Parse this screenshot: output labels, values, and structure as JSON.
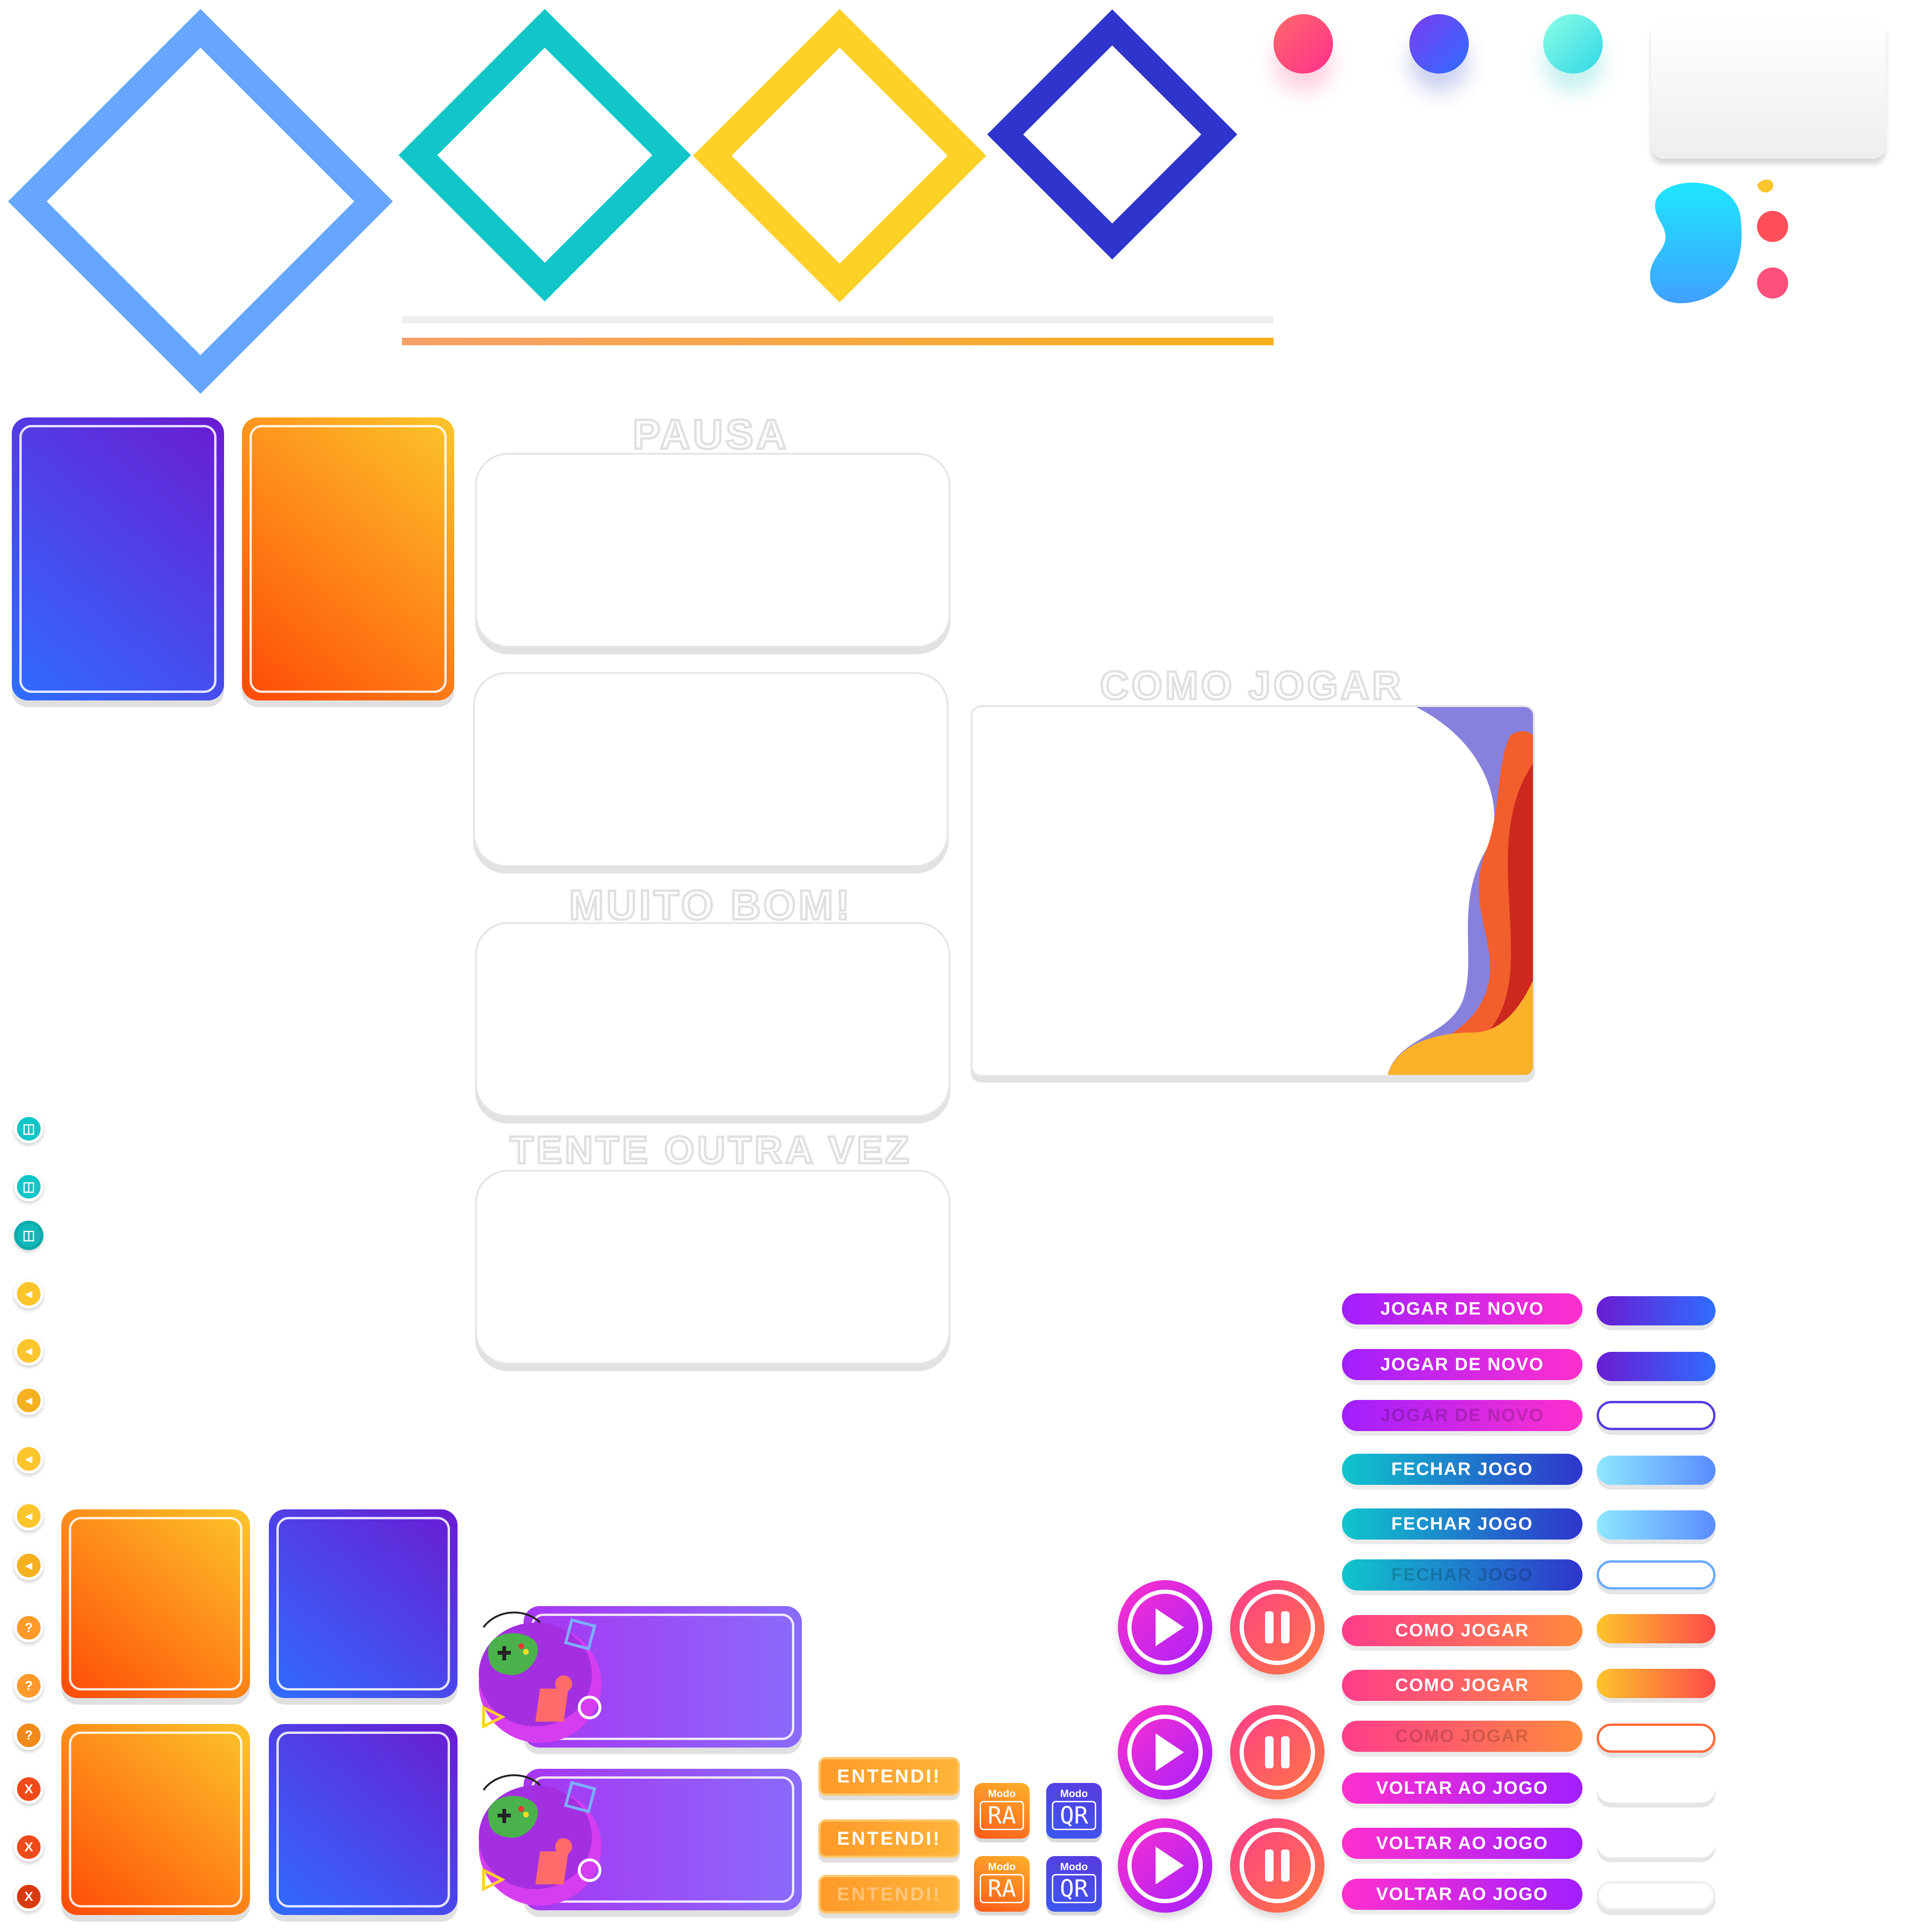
{
  "colors": {
    "blue_diamond": "#66a6ff",
    "teal_diamond": "#10c6c9",
    "yellow_diamond": "#fdd128",
    "navy_diamond": "#2f35cc",
    "pink": "#ff4f7b",
    "purple_gradient": [
      "#2f6dff",
      "#6a1bd2"
    ],
    "orange_gradient": [
      "#ff4a06",
      "#fcc52b"
    ],
    "teal_gradient": [
      "#0fc6cc",
      "#2f35cc"
    ],
    "magenta_gradient": [
      "#ff30cc",
      "#a11ffe"
    ]
  },
  "panels": {
    "pausa_title": "PAUSA",
    "muito_bom_title": "MUITO BOM!",
    "tente_title": "TENTE OUTRA VEZ",
    "como_jogar_title": "COMO JOGAR"
  },
  "buttons": {
    "jogar_de_novo": "JOGAR DE NOVO",
    "fechar_jogo": "FECHAR JOGO",
    "como_jogar": "COMO JOGAR",
    "voltar_ao_jogo": "VOLTAR AO JOGO",
    "entendi": "ENTENDI!",
    "modo_label": "Modo",
    "modo_ra": "RA",
    "modo_qr": "QR"
  },
  "icons": {
    "vibrate": "vibrate-icon",
    "sound": "speaker-icon",
    "help": "?",
    "close": "X",
    "play": "play-icon",
    "pause": "pause-icon"
  }
}
